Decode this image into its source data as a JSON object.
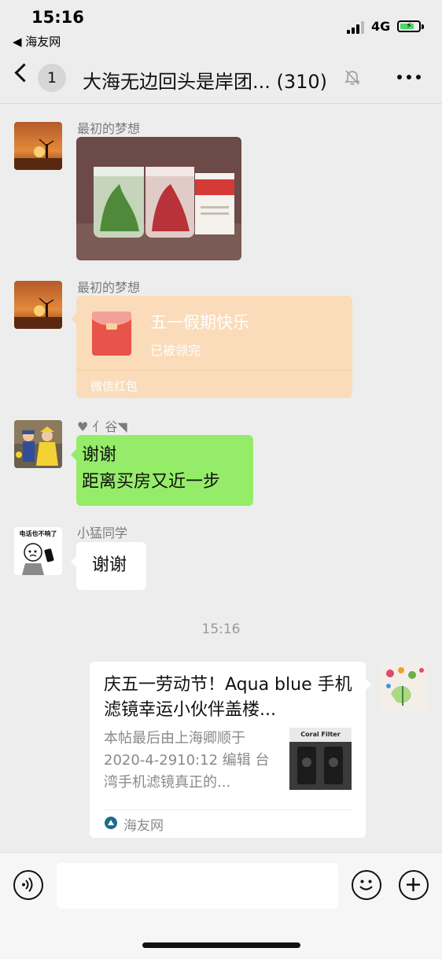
{
  "status_bar": {
    "time": "15:16",
    "back_app": "◀ 海友网",
    "network": "4G"
  },
  "nav": {
    "unread_count": "1",
    "title": "大海无边回头是岸团... (310)"
  },
  "messages": [
    {
      "sender": "最初的梦想",
      "type": "image"
    },
    {
      "sender": "最初的梦想",
      "type": "red_packet",
      "red_packet": {
        "greeting": "五一假期快乐",
        "status": "已被领完",
        "label": "微信红包"
      }
    },
    {
      "sender": "♥       亻谷◥",
      "type": "text",
      "lines": [
        "谢谢",
        "距离买房又近一步"
      ]
    },
    {
      "sender": "小猛同学",
      "type": "text",
      "text": "谢谢"
    }
  ],
  "timestamp": "15:16",
  "article": {
    "title": "庆五一劳动节！Aqua blue 手机滤镜幸运小伙伴盖楼...",
    "description": "本帖最后由上海卿顺于 2020-4-2910:12 编辑 台湾手机滤镜真正的...",
    "thumbnail_text": "Coral Filter",
    "source": "海友网"
  },
  "avatar_texts": {
    "sticker_caption": "电话也不响了"
  }
}
